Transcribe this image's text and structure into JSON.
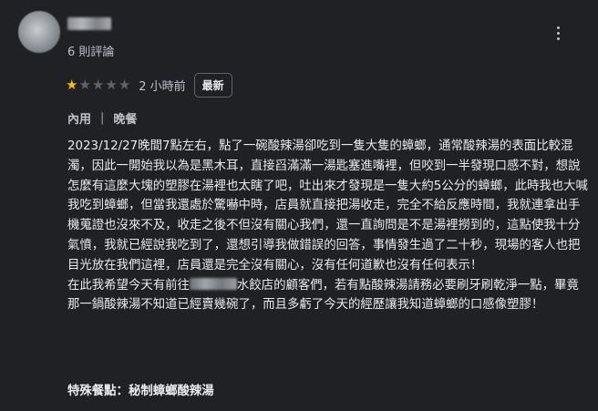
{
  "review": {
    "count_text": "6 則評論",
    "rating": 1,
    "rating_max": 5,
    "time_ago": "2 小時前",
    "badge": "最新",
    "meta": {
      "service": "內用",
      "separator": "|",
      "meal": "晚餐"
    },
    "body_part1": "2023/12/27晚間7點左右，點了一碗酸辣湯卻吃到一隻大隻的蟑螂，通常酸辣湯的表面比較混濁，因此一開始我以為是黑木耳，直接舀滿滿一湯匙塞進嘴裡，但咬到一半發現口感不對，想說怎麼有這麼大塊的塑膠在湯裡也太瞎了吧，吐出來才發現是一隻大約5公分的蟑螂，此時我也大喊我吃到蟑螂，但當我還處於驚嚇中時，店員就直接把湯收走，完全不給反應時間，我就連拿出手機蒐證也沒來不及，收走之後不但沒有關心我們，還一直詢問是不是湯裡撈到的，這點使我十分氣憤，我就已經說我吃到了，還想引導我做錯誤的回答，事情發生過了二十秒，現場的客人也把目光放在我們這裡，店員還是完全沒有關心，沒有任何道歉也沒有任何表示！",
    "body_part2_before": "在此我希望今天有前往",
    "body_part2_after": "水餃店的顧客們，若有點酸辣湯請務必要刷牙刷乾淨一點，畢竟那一鍋酸辣湯不知道已經賣幾碗了，而且多虧了今天的經歷讓我知道蟑螂的口感像塑膠！",
    "special_label": "特殊餐點：",
    "special_value": "秘制蟑螂酸辣湯"
  },
  "icons": {
    "star": "star-icon",
    "menu": "more-vert-icon"
  },
  "colors": {
    "background": "#202124",
    "star_active": "#fbbc04",
    "star_inactive": "#5f6368",
    "text_primary": "#e8eaed",
    "text_secondary": "#bdc1c6"
  }
}
